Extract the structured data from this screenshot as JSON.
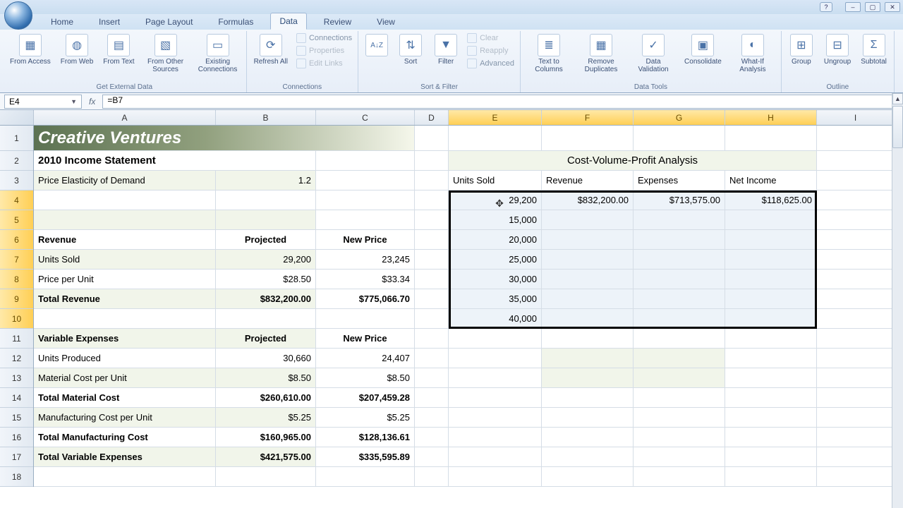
{
  "window": {
    "help": "?",
    "min": "–",
    "max": "▢",
    "close": "✕"
  },
  "ribbon_tabs": {
    "home": "Home",
    "insert": "Insert",
    "page_layout": "Page Layout",
    "formulas": "Formulas",
    "data": "Data",
    "review": "Review",
    "view": "View"
  },
  "ribbon": {
    "external": {
      "from_access": "From Access",
      "from_web": "From Web",
      "from_text": "From Text",
      "from_other": "From Other Sources",
      "existing": "Existing Connections",
      "title": "Get External Data"
    },
    "connections": {
      "refresh": "Refresh All",
      "connections": "Connections",
      "properties": "Properties",
      "edit_links": "Edit Links",
      "title": "Connections"
    },
    "sortfilter": {
      "sort": "Sort",
      "filter": "Filter",
      "clear": "Clear",
      "reapply": "Reapply",
      "advanced": "Advanced",
      "title": "Sort & Filter"
    },
    "datatools": {
      "text_to_cols": "Text to Columns",
      "remove_dup": "Remove Duplicates",
      "validation": "Data Validation",
      "consolidate": "Consolidate",
      "whatif": "What-If Analysis",
      "title": "Data Tools"
    },
    "outline": {
      "group": "Group",
      "ungroup": "Ungroup",
      "subtotal": "Subtotal",
      "title": "Outline"
    }
  },
  "fbar": {
    "name": "E4",
    "fx": "fx",
    "formula": "=B7"
  },
  "cols": {
    "A": "A",
    "B": "B",
    "C": "C",
    "D": "D",
    "E": "E",
    "F": "F",
    "G": "G",
    "H": "H",
    "I": "I"
  },
  "rows": [
    "1",
    "2",
    "3",
    "4",
    "5",
    "6",
    "7",
    "8",
    "9",
    "10",
    "11",
    "12",
    "13",
    "14",
    "15",
    "16",
    "17",
    "18"
  ],
  "sheet": {
    "title": "Creative Ventures",
    "subtitle": "2010 Income Statement",
    "ped_label": "Price Elasticity of Demand",
    "ped_value": "1.2",
    "revenue_hdr": "Revenue",
    "projected": "Projected",
    "new_price": "New Price",
    "units_sold": "Units Sold",
    "us_b": "29,200",
    "us_c": "23,245",
    "ppu": "Price per Unit",
    "ppu_b": "$28.50",
    "ppu_c": "$33.34",
    "tot_rev": "Total Revenue",
    "tot_rev_b": "$832,200.00",
    "tot_rev_c": "$775,066.70",
    "var_exp": "Variable Expenses",
    "units_prod": "Units Produced",
    "up_b": "30,660",
    "up_c": "24,407",
    "mat_cost": "Material Cost per Unit",
    "mc_b": "$8.50",
    "mc_c": "$8.50",
    "tot_mat": "Total Material Cost",
    "tm_b": "$260,610.00",
    "tm_c": "$207,459.28",
    "mfg_cost": "Manufacturing Cost per Unit",
    "mfg_b": "$5.25",
    "mfg_c": "$5.25",
    "tot_mfg": "Total Manufacturing Cost",
    "tmfg_b": "$160,965.00",
    "tmfg_c": "$128,136.61",
    "tot_var": "Total Variable Expenses",
    "tv_b": "$421,575.00",
    "tv_c": "$335,595.89",
    "cvp_title": "Cost-Volume-Profit Analysis",
    "cvp_units": "Units Sold",
    "cvp_rev": "Revenue",
    "cvp_exp": "Expenses",
    "cvp_ni": "Net Income",
    "cvp_r1_u": "29,200",
    "cvp_r1_r": "$832,200.00",
    "cvp_r1_e": "$713,575.00",
    "cvp_r1_n": "$118,625.00",
    "cvp_r2_u": "15,000",
    "cvp_r3_u": "20,000",
    "cvp_r4_u": "25,000",
    "cvp_r5_u": "30,000",
    "cvp_r6_u": "35,000",
    "cvp_r7_u": "40,000"
  },
  "chart_data": {
    "type": "table",
    "title": "Cost-Volume-Profit Analysis",
    "columns": [
      "Units Sold",
      "Revenue",
      "Expenses",
      "Net Income"
    ],
    "rows": [
      {
        "units_sold": 29200,
        "revenue": 832200.0,
        "expenses": 713575.0,
        "net_income": 118625.0
      },
      {
        "units_sold": 15000,
        "revenue": null,
        "expenses": null,
        "net_income": null
      },
      {
        "units_sold": 20000,
        "revenue": null,
        "expenses": null,
        "net_income": null
      },
      {
        "units_sold": 25000,
        "revenue": null,
        "expenses": null,
        "net_income": null
      },
      {
        "units_sold": 30000,
        "revenue": null,
        "expenses": null,
        "net_income": null
      },
      {
        "units_sold": 35000,
        "revenue": null,
        "expenses": null,
        "net_income": null
      },
      {
        "units_sold": 40000,
        "revenue": null,
        "expenses": null,
        "net_income": null
      }
    ]
  }
}
